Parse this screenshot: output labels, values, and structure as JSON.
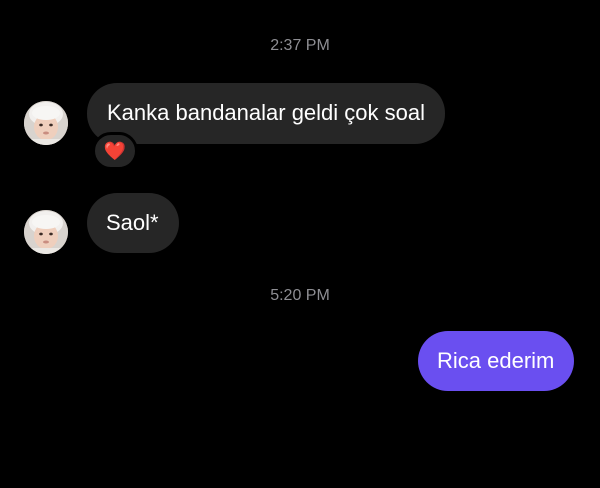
{
  "conversation": {
    "messages": [
      {
        "type": "timestamp",
        "text": "2:37 PM"
      },
      {
        "type": "incoming",
        "text": "Kanka bandanalar geldi çok soal",
        "reaction": "❤️"
      },
      {
        "type": "incoming",
        "text": "Saol*"
      },
      {
        "type": "timestamp",
        "text": "5:20 PM"
      },
      {
        "type": "outgoing",
        "text": "Rica ederim"
      }
    ]
  },
  "colors": {
    "background": "#000000",
    "incoming_bubble": "#262626",
    "outgoing_bubble": "#6a4ff0",
    "timestamp_text": "#8e8e93",
    "reaction_heart": "#e8232e"
  },
  "icons": {
    "avatar": "baby-profile-photo",
    "reaction": "heart-icon"
  }
}
